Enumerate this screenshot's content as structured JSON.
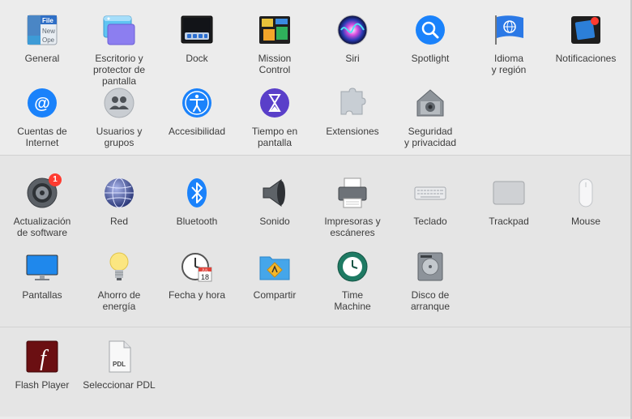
{
  "sections": [
    {
      "panes": [
        {
          "id": "general",
          "label": "General",
          "icon": "general-icon"
        },
        {
          "id": "escritorio",
          "label": "Escritorio y\nprotector de pantalla",
          "icon": "desktop-screensaver-icon"
        },
        {
          "id": "dock",
          "label": "Dock",
          "icon": "dock-icon"
        },
        {
          "id": "mission-control",
          "label": "Mission\nControl",
          "icon": "mission-control-icon"
        },
        {
          "id": "siri",
          "label": "Siri",
          "icon": "siri-icon"
        },
        {
          "id": "spotlight",
          "label": "Spotlight",
          "icon": "spotlight-icon"
        },
        {
          "id": "idioma",
          "label": "Idioma\ny región",
          "icon": "language-region-icon"
        },
        {
          "id": "notificaciones",
          "label": "Notificaciones",
          "icon": "notifications-icon"
        },
        {
          "id": "cuentas",
          "label": "Cuentas de\nInternet",
          "icon": "internet-accounts-icon"
        },
        {
          "id": "usuarios",
          "label": "Usuarios y\ngrupos",
          "icon": "users-groups-icon"
        },
        {
          "id": "accesibilidad",
          "label": "Accesibilidad",
          "icon": "accessibility-icon"
        },
        {
          "id": "tiempo",
          "label": "Tiempo en\npantalla",
          "icon": "screen-time-icon"
        },
        {
          "id": "extensiones",
          "label": "Extensiones",
          "icon": "extensions-icon"
        },
        {
          "id": "seguridad",
          "label": "Seguridad\ny privacidad",
          "icon": "security-privacy-icon"
        }
      ]
    },
    {
      "panes": [
        {
          "id": "actualizacion",
          "label": "Actualización\nde software",
          "icon": "software-update-icon",
          "badge": "1"
        },
        {
          "id": "red",
          "label": "Red",
          "icon": "network-icon"
        },
        {
          "id": "bluetooth",
          "label": "Bluetooth",
          "icon": "bluetooth-icon"
        },
        {
          "id": "sonido",
          "label": "Sonido",
          "icon": "sound-icon"
        },
        {
          "id": "impresoras",
          "label": "Impresoras y\nescáneres",
          "icon": "printers-scanners-icon"
        },
        {
          "id": "teclado",
          "label": "Teclado",
          "icon": "keyboard-icon"
        },
        {
          "id": "trackpad",
          "label": "Trackpad",
          "icon": "trackpad-icon"
        },
        {
          "id": "mouse",
          "label": "Mouse",
          "icon": "mouse-icon"
        },
        {
          "id": "pantallas",
          "label": "Pantallas",
          "icon": "displays-icon"
        },
        {
          "id": "ahorro",
          "label": "Ahorro de\nenergía",
          "icon": "energy-saver-icon"
        },
        {
          "id": "fecha",
          "label": "Fecha y hora",
          "icon": "date-time-icon"
        },
        {
          "id": "compartir",
          "label": "Compartir",
          "icon": "sharing-icon"
        },
        {
          "id": "time-machine",
          "label": "Time\nMachine",
          "icon": "time-machine-icon"
        },
        {
          "id": "disco",
          "label": "Disco de\narranque",
          "icon": "startup-disk-icon"
        }
      ]
    },
    {
      "panes": [
        {
          "id": "flash",
          "label": "Flash Player",
          "icon": "flash-player-icon"
        },
        {
          "id": "pdl",
          "label": "Seleccionar PDL",
          "icon": "select-pdl-icon"
        }
      ]
    }
  ],
  "icon_text": {
    "general_lines": [
      "File",
      "New",
      "Ope"
    ],
    "calendar_month": "JUL",
    "calendar_day": "18",
    "flash_glyph": "f",
    "pdl_text": "PDL"
  },
  "colors": {
    "accent_blue": "#1a82fb",
    "badge_red": "#ff3b30"
  }
}
